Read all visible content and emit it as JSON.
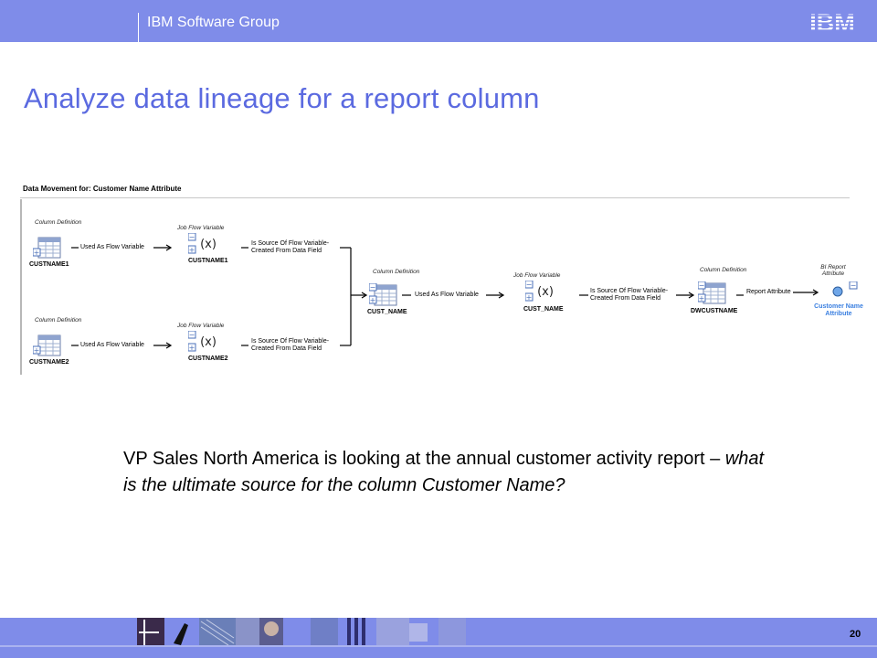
{
  "header": {
    "group": "IBM Software Group",
    "logo_text": "IBM",
    "color": "#7f8ce9"
  },
  "title": "Analyze data lineage for a report column",
  "diagram": {
    "title": "Data Movement for: Customer Name Attribute",
    "nodes": [
      {
        "type": "Column Definition",
        "name": "CUSTNAME1",
        "icon": "table-icon"
      },
      {
        "type": "Job Flow Variable",
        "name": "CUSTNAME1",
        "icon": "variable-icon"
      },
      {
        "type": "Column Definition",
        "name": "CUSTNAME2",
        "icon": "table-icon"
      },
      {
        "type": "Job Flow Variable",
        "name": "CUSTNAME2",
        "icon": "variable-icon"
      },
      {
        "type": "Column Definition",
        "name": "CUST_NAME",
        "icon": "table-icon"
      },
      {
        "type": "Job Flow Variable",
        "name": "CUST_NAME",
        "icon": "variable-icon"
      },
      {
        "type": "Column Definition",
        "name": "DWCUSTNAME",
        "icon": "table-icon"
      },
      {
        "type": "BI Report Attribute",
        "name": "Customer Name Attribute",
        "icon": "report-attribute-icon"
      }
    ],
    "edges": [
      {
        "label": "Used As Flow Variable"
      },
      {
        "label": "Is Source Of Flow Variable- Created From Data Field"
      },
      {
        "label": "Used As Flow Variable"
      },
      {
        "label": "Is Source Of Flow Variable- Created From Data Field"
      },
      {
        "label": "Used As Flow Variable"
      },
      {
        "label": "Is Source Of Flow Variable- Created From Data Field"
      },
      {
        "label": "Report Attribute"
      }
    ]
  },
  "body": {
    "plain": "VP Sales North America is looking at the annual customer activity report – ",
    "italic": "what is the ultimate source for the column Customer Name?"
  },
  "footer": {
    "page_number": "20"
  }
}
